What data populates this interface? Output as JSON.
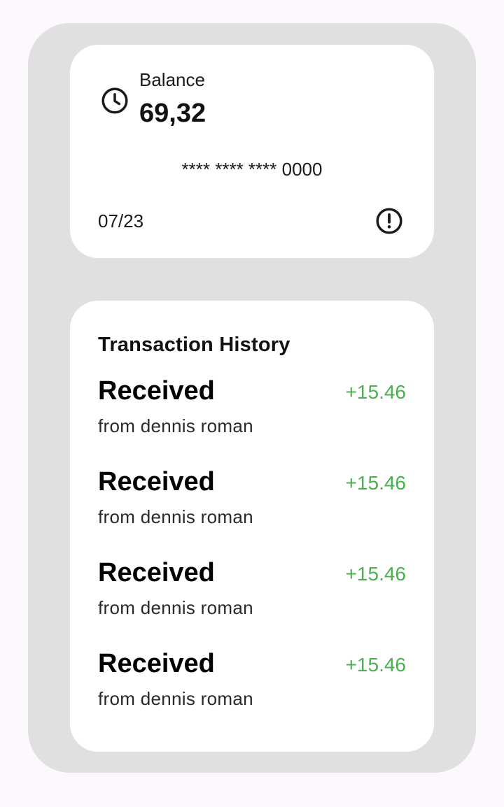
{
  "balance_card": {
    "label": "Balance",
    "amount": "69,32",
    "card_number": "**** **** **** 0000",
    "expiry": "07/23",
    "icons": [
      "clock-icon",
      "alert-circle-icon"
    ]
  },
  "history": {
    "title": "Transaction History",
    "items": [
      {
        "title": "Received",
        "subtitle": "from dennis roman",
        "amount": "+15.46"
      },
      {
        "title": "Received",
        "subtitle": "from dennis roman",
        "amount": "+15.46"
      },
      {
        "title": "Received",
        "subtitle": "from dennis roman",
        "amount": "+15.46"
      },
      {
        "title": "Received",
        "subtitle": "from dennis roman",
        "amount": "+15.46"
      }
    ]
  },
  "colors": {
    "background": "#fdf8fd",
    "container": "#e0e0e0",
    "card": "#ffffff",
    "positive_amount": "#4caf50"
  }
}
